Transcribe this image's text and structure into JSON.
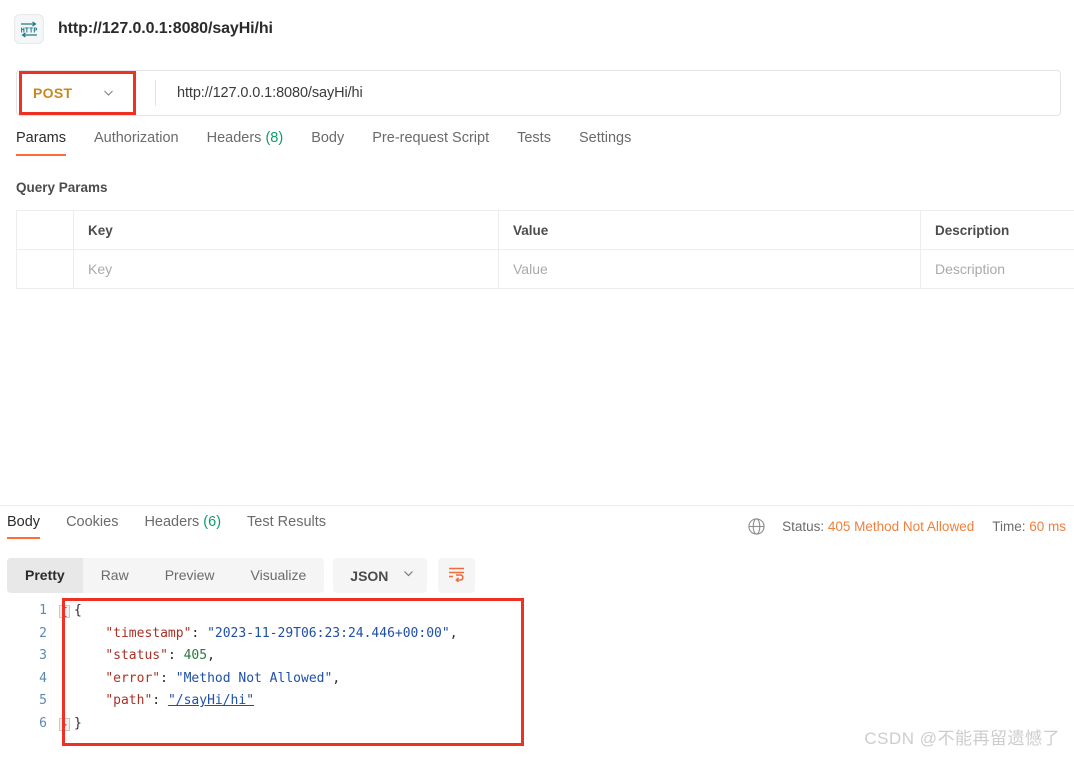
{
  "header": {
    "icon": "http-protocol-icon",
    "title": "http://127.0.0.1:8080/sayHi/hi"
  },
  "url_bar": {
    "method": "POST",
    "method_chevron": "chevron-down-icon",
    "url": "http://127.0.0.1:8080/sayHi/hi",
    "annotation_color": "#ef3124"
  },
  "request_tabs": [
    {
      "label": "Params",
      "count": "",
      "active": true
    },
    {
      "label": "Authorization",
      "count": "",
      "active": false
    },
    {
      "label": "Headers",
      "count": "(8)",
      "active": false
    },
    {
      "label": "Body",
      "count": "",
      "active": false
    },
    {
      "label": "Pre-request Script",
      "count": "",
      "active": false
    },
    {
      "label": "Tests",
      "count": "",
      "active": false
    },
    {
      "label": "Settings",
      "count": "",
      "active": false
    }
  ],
  "query_params": {
    "section_label": "Query Params",
    "columns": [
      "",
      "Key",
      "Value",
      "Description"
    ],
    "rows": [
      {
        "check": "",
        "key": "Key",
        "value": "Value",
        "description": "Description"
      }
    ]
  },
  "response_tabs": [
    {
      "label": "Body",
      "count": "",
      "active": true
    },
    {
      "label": "Cookies",
      "count": "",
      "active": false
    },
    {
      "label": "Headers",
      "count": "(6)",
      "active": false
    },
    {
      "label": "Test Results",
      "count": "",
      "active": false
    }
  ],
  "response_meta": {
    "globe_icon": "globe-icon",
    "status_label": "Status:",
    "status_value": "405 Method Not Allowed",
    "time_label": "Time:",
    "time_value": "60 ms",
    "accent_color": "#f0803c"
  },
  "format_toolbar": {
    "view_modes": [
      {
        "label": "Pretty",
        "active": true
      },
      {
        "label": "Raw",
        "active": false
      },
      {
        "label": "Preview",
        "active": false
      },
      {
        "label": "Visualize",
        "active": false
      }
    ],
    "language": "JSON",
    "language_chevron": "chevron-down-icon",
    "wrap_button_icon": "wrap-lines-icon"
  },
  "code_viewer": {
    "line_numbers": [
      "1",
      "2",
      "3",
      "4",
      "5",
      "6"
    ],
    "fold_open": "{",
    "fold_close": "}",
    "lines": [
      {
        "indent": "",
        "text": "{",
        "type": "punct"
      },
      {
        "indent": "    ",
        "key": "\"timestamp\"",
        "sep": ": ",
        "value": "\"2023-11-29T06:23:24.446+00:00\"",
        "type": "string",
        "trail": ","
      },
      {
        "indent": "    ",
        "key": "\"status\"",
        "sep": ": ",
        "value": "405",
        "type": "number",
        "trail": ","
      },
      {
        "indent": "    ",
        "key": "\"error\"",
        "sep": ": ",
        "value": "\"Method Not Allowed\"",
        "type": "string",
        "trail": ","
      },
      {
        "indent": "    ",
        "key": "\"path\"",
        "sep": ": ",
        "value": "\"/sayHi/hi\"",
        "type": "link",
        "trail": ""
      },
      {
        "indent": "",
        "text": "}",
        "type": "punct"
      }
    ],
    "response_json": {
      "timestamp": "2023-11-29T06:23:24.446+00:00",
      "status": 405,
      "error": "Method Not Allowed",
      "path": "/sayHi/hi"
    },
    "annotation_color": "#ef3124"
  },
  "watermark": "CSDN @不能再留遗憾了"
}
